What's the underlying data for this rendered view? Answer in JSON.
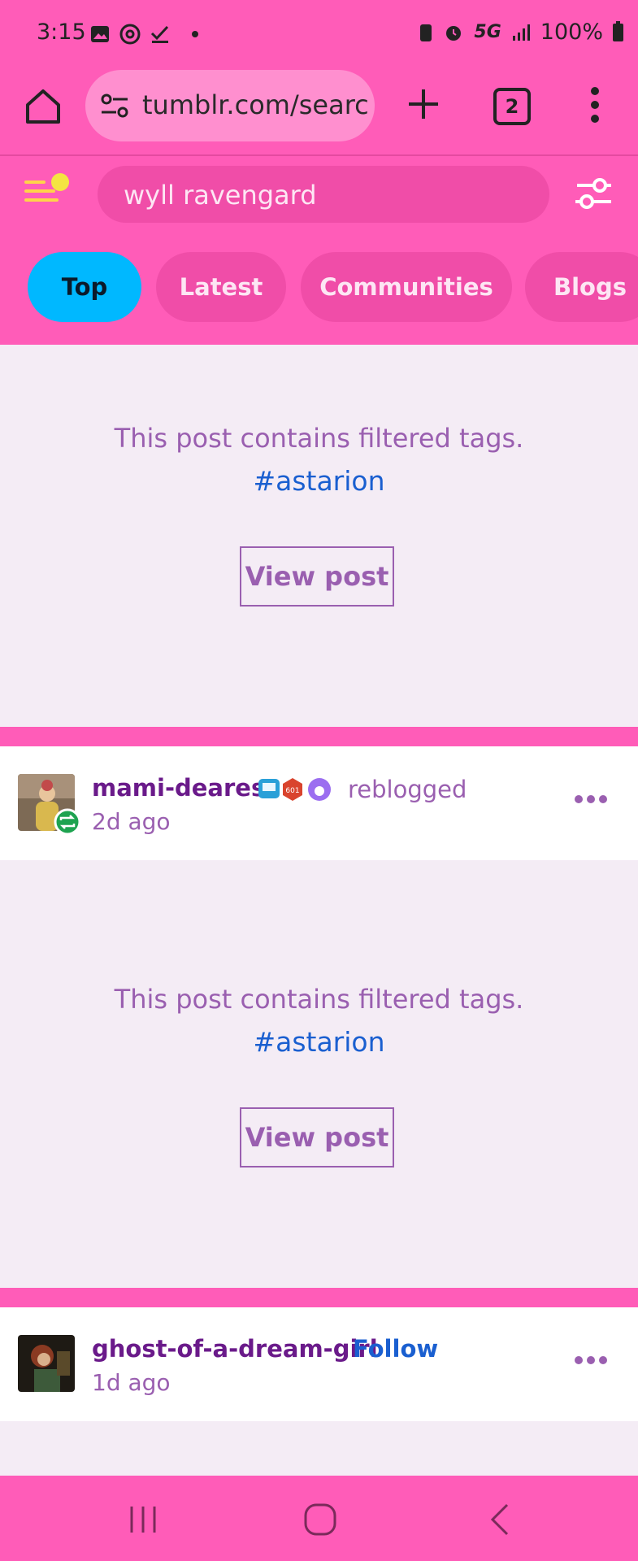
{
  "status_bar": {
    "time": "3:15",
    "network": "5G",
    "battery": "100%",
    "left_icons": [
      "image-icon",
      "threads-icon",
      "check-icon",
      "dot-icon"
    ],
    "right_icons": [
      "battery-saver-icon",
      "alarm-icon",
      "signal-icon",
      "battery-icon"
    ]
  },
  "browser": {
    "url": "tumblr.com/search",
    "tab_count": "2"
  },
  "search": {
    "query": "wyll ravengard"
  },
  "tabs": [
    {
      "label": "Top",
      "active": true
    },
    {
      "label": "Latest",
      "active": false
    },
    {
      "label": "Communities",
      "active": false
    },
    {
      "label": "Blogs",
      "active": false
    }
  ],
  "posts": [
    {
      "filtered_message": "This post contains filtered tags.",
      "filtered_tag": "#astarion",
      "view_label": "View post"
    },
    {
      "blog": "mami-dearest",
      "action": "reblogged",
      "time": "2d ago",
      "filtered_message": "This post contains filtered tags.",
      "filtered_tag": "#astarion",
      "view_label": "View post"
    },
    {
      "blog": "ghost-of-a-dream-girl",
      "action": "Follow",
      "time": "1d ago"
    }
  ],
  "colors": {
    "brand_pink": "#ff5cb8",
    "active_tab": "#00b8ff",
    "link_blue": "#1a5fd0",
    "blog_name": "#6a1a8a"
  }
}
